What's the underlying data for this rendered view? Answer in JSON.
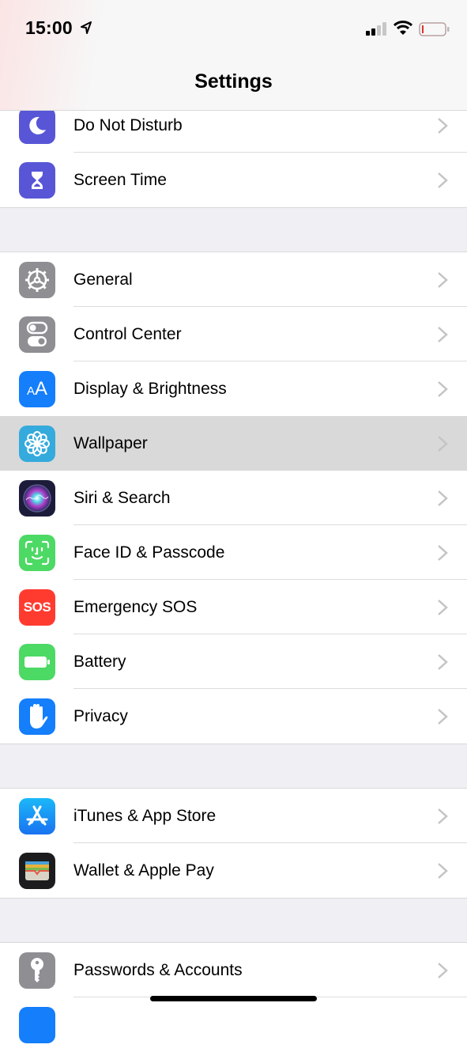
{
  "status_bar": {
    "time": "15:00",
    "location_icon": "location-arrow-icon",
    "signal_icon": "cellular-signal-icon",
    "signal_bars_active": 2,
    "signal_bars_total": 4,
    "wifi_icon": "wifi-icon",
    "battery_icon": "battery-icon",
    "battery_level": 0.05
  },
  "nav": {
    "title": "Settings"
  },
  "groups": [
    {
      "items": [
        {
          "label": "Do Not Disturb",
          "icon": "moon-icon",
          "color": "#5856d6"
        },
        {
          "label": "Screen Time",
          "icon": "hourglass-icon",
          "color": "#5856d6"
        }
      ]
    },
    {
      "items": [
        {
          "label": "General",
          "icon": "gear-icon",
          "color": "#8e8e93"
        },
        {
          "label": "Control Center",
          "icon": "toggles-icon",
          "color": "#8e8e93"
        },
        {
          "label": "Display & Brightness",
          "icon": "text-size-icon",
          "color": "#147efb"
        },
        {
          "label": "Wallpaper",
          "icon": "flower-icon",
          "color": "#35aadc",
          "selected": true
        },
        {
          "label": "Siri & Search",
          "icon": "siri-icon",
          "color": "#1c1c3a"
        },
        {
          "label": "Face ID & Passcode",
          "icon": "face-id-icon",
          "color": "#4cd964"
        },
        {
          "label": "Emergency SOS",
          "icon": "sos-icon",
          "color": "#ff3b30",
          "icon_text": "SOS"
        },
        {
          "label": "Battery",
          "icon": "battery-icon",
          "color": "#4cd964"
        },
        {
          "label": "Privacy",
          "icon": "hand-icon",
          "color": "#147efb"
        }
      ]
    },
    {
      "items": [
        {
          "label": "iTunes & App Store",
          "icon": "app-store-icon",
          "color": "#1a8cf8"
        },
        {
          "label": "Wallet & Apple Pay",
          "icon": "wallet-icon",
          "color": "#1c1c1e"
        }
      ]
    },
    {
      "items": [
        {
          "label": "Passwords & Accounts",
          "icon": "key-icon",
          "color": "#8e8e93"
        },
        {
          "label": "",
          "icon": "partial-icon",
          "color": "#147efb"
        }
      ]
    }
  ],
  "display_a_small": "A",
  "display_a_large": "A"
}
